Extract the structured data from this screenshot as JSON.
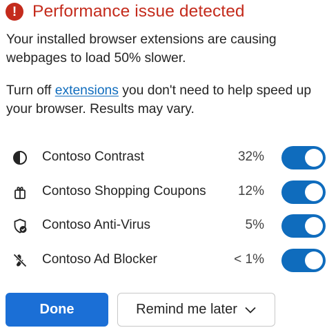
{
  "header": {
    "alert_icon": "exclamation-circle-icon",
    "title": "Performance issue detected"
  },
  "message": {
    "line1": "Your installed browser extensions are causing webpages to load 50% slower.",
    "line2_prefix": "Turn off ",
    "line2_link": "extensions",
    "line2_suffix": " you don't need to help speed up your browser. Results may vary."
  },
  "extensions": [
    {
      "name": "Contoso Contrast",
      "impact": "32%",
      "icon": "contrast-icon",
      "enabled": true
    },
    {
      "name": "Contoso Shopping Coupons",
      "impact": "12%",
      "icon": "gift-icon",
      "enabled": true
    },
    {
      "name": "Contoso Anti-Virus",
      "impact": "5%",
      "icon": "shield-check-icon",
      "enabled": true
    },
    {
      "name": "Contoso Ad Blocker",
      "impact": "< 1%",
      "icon": "hand-block-icon",
      "enabled": true
    }
  ],
  "buttons": {
    "done": "Done",
    "remind": "Remind me later"
  },
  "colors": {
    "alert": "#c42b1c",
    "accent": "#0f6cbd",
    "primary_button": "#1b6fd6"
  }
}
